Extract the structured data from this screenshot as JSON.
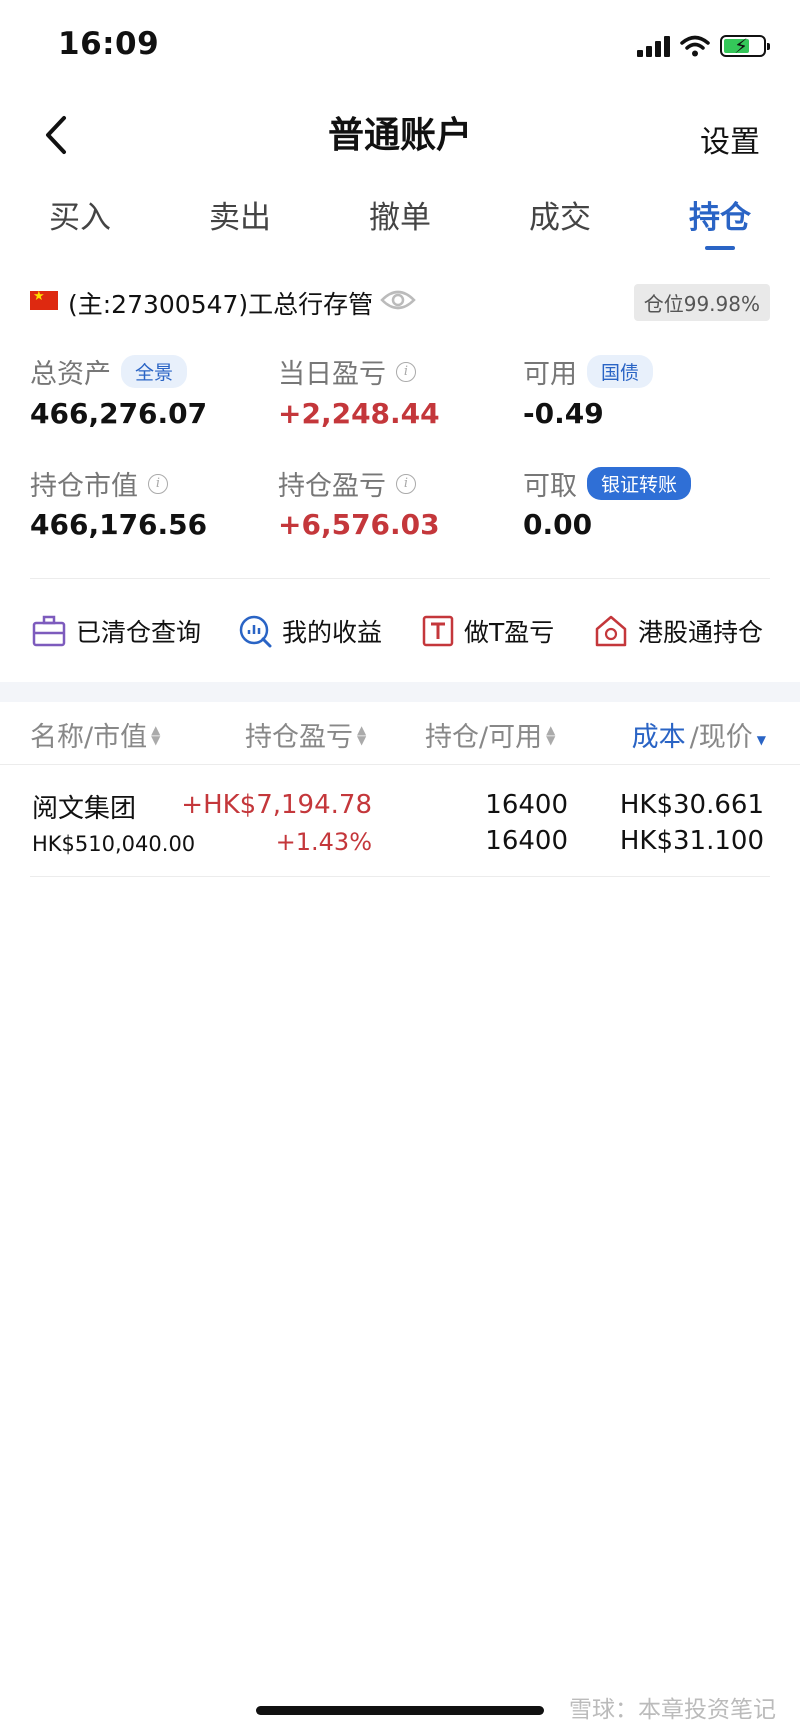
{
  "status": {
    "time": "16:09"
  },
  "nav": {
    "title": "普通账户",
    "settings": "设置"
  },
  "tabs": [
    {
      "label": "买入"
    },
    {
      "label": "卖出"
    },
    {
      "label": "撤单"
    },
    {
      "label": "成交"
    },
    {
      "label": "持仓"
    }
  ],
  "account": {
    "name": "(主:27300547)工总行存管",
    "position_ratio": "仓位99.98%"
  },
  "stats": {
    "total_assets": {
      "label": "总资产",
      "chip": "全景",
      "value": "466,276.07"
    },
    "daily_pnl": {
      "label": "当日盈亏",
      "value": "+2,248.44"
    },
    "available": {
      "label": "可用",
      "chip": "国债",
      "value": "-0.49"
    },
    "market_value": {
      "label": "持仓市值",
      "value": "466,176.56"
    },
    "position_pnl": {
      "label": "持仓盈亏",
      "value": "+6,576.03"
    },
    "withdrawable": {
      "label": "可取",
      "chip": "银证转账",
      "value": "0.00"
    }
  },
  "tools": {
    "cleared": "已清仓查询",
    "earnings": "我的收益",
    "t_trade": "做T盈亏",
    "hk_connect": "港股通持仓"
  },
  "table": {
    "headers": {
      "name": "名称/市值",
      "pnl": "持仓盈亏",
      "qty": "持仓/可用",
      "cost_a": "成本",
      "cost_b": "/现价"
    },
    "rows": [
      {
        "name": "阅文集团",
        "market_value": "HK$510,040.00",
        "pnl": "+HK$7,194.78",
        "pnl_pct": "+1.43%",
        "qty": "16400",
        "available": "16400",
        "cost": "HK$30.661",
        "price": "HK$31.100"
      }
    ]
  },
  "watermark": "雪球：本章投资笔记",
  "colors": {
    "accent": "#2a64c5",
    "gain": "#c4373b"
  }
}
